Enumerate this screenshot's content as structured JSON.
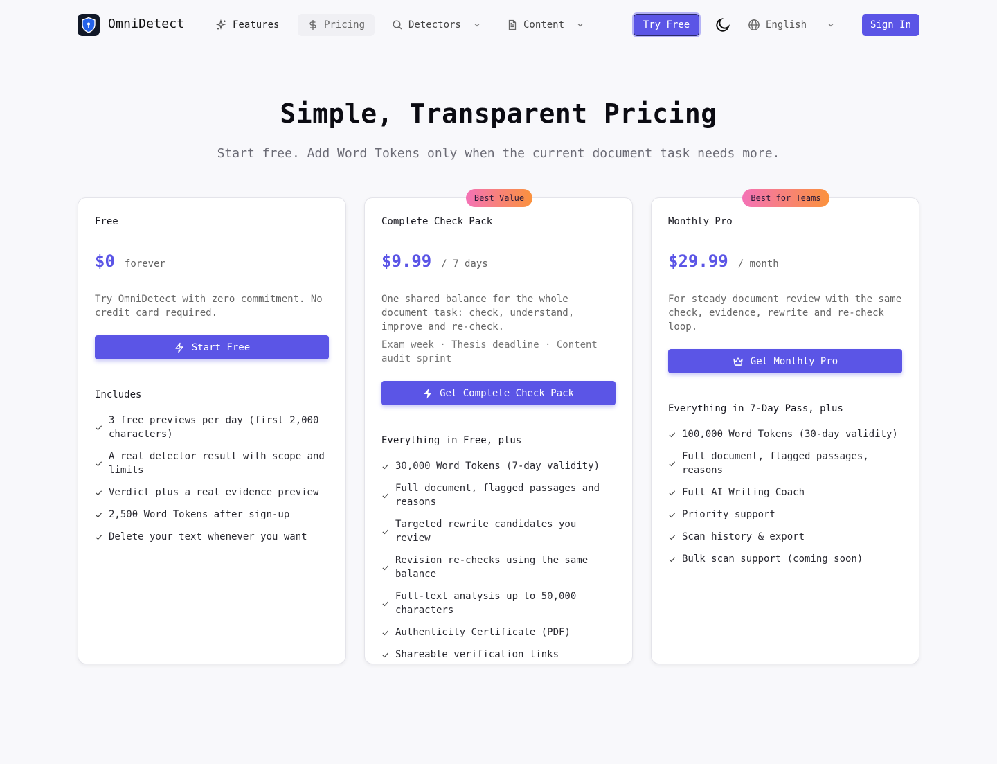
{
  "header": {
    "brand": "OmniDetect",
    "nav": [
      {
        "label": "Features",
        "icon": "sparkles-icon"
      },
      {
        "label": "Pricing",
        "icon": "dollar-icon"
      },
      {
        "label": "Detectors",
        "icon": "search-icon"
      },
      {
        "label": "Content",
        "icon": "document-icon"
      }
    ],
    "try_free": "Try Free",
    "language": "English",
    "sign_in": "Sign In"
  },
  "hero": {
    "title": "Simple, Transparent Pricing",
    "subtitle": "Start free. Add Word Tokens only when the current document task needs more."
  },
  "colors": {
    "accent": "#5b55e6",
    "badge_from": "#f472b6",
    "badge_to": "#fb923c"
  },
  "plans": [
    {
      "name": "Free",
      "price": "$0",
      "period": "forever",
      "description": "Try OmniDetect with zero commitment. No credit card required.",
      "cta": "Start Free",
      "cta_icon": "lightning-outline-icon",
      "features_title": "Includes",
      "features": [
        "3 free previews per day (first 2,000 characters)",
        "A real detector result with scope and limits",
        "Verdict plus a real evidence preview",
        "2,500 Word Tokens after sign-up",
        "Delete your text whenever you want"
      ]
    },
    {
      "badge": "Best Value",
      "name": "Complete Check Pack",
      "price": "$9.99",
      "period": "/ 7 days",
      "description": "One shared balance for the whole document task: check, understand, improve and re-check.",
      "note": "Exam week · Thesis deadline · Content audit sprint",
      "cta": "Get Complete Check Pack",
      "cta_icon": "lightning-filled-icon",
      "features_title": "Everything in Free, plus",
      "features": [
        "30,000 Word Tokens (7-day validity)",
        "Full document, flagged passages and reasons",
        "Targeted rewrite candidates you review",
        "Revision re-checks using the same balance",
        "Full-text analysis up to 50,000 characters",
        "Authenticity Certificate (PDF)",
        "Shareable verification links"
      ]
    },
    {
      "badge": "Best for Teams",
      "name": "Monthly Pro",
      "price": "$29.99",
      "period": "/ month",
      "description": "For steady document review with the same check, evidence, rewrite and re-check loop.",
      "cta": "Get Monthly Pro",
      "cta_icon": "crown-icon",
      "features_title": "Everything in 7-Day Pass, plus",
      "features": [
        "100,000 Word Tokens (30-day validity)",
        "Full document, flagged passages, reasons",
        "Full AI Writing Coach",
        "Priority support",
        "Scan history & export",
        "Bulk scan support (coming soon)"
      ]
    }
  ]
}
